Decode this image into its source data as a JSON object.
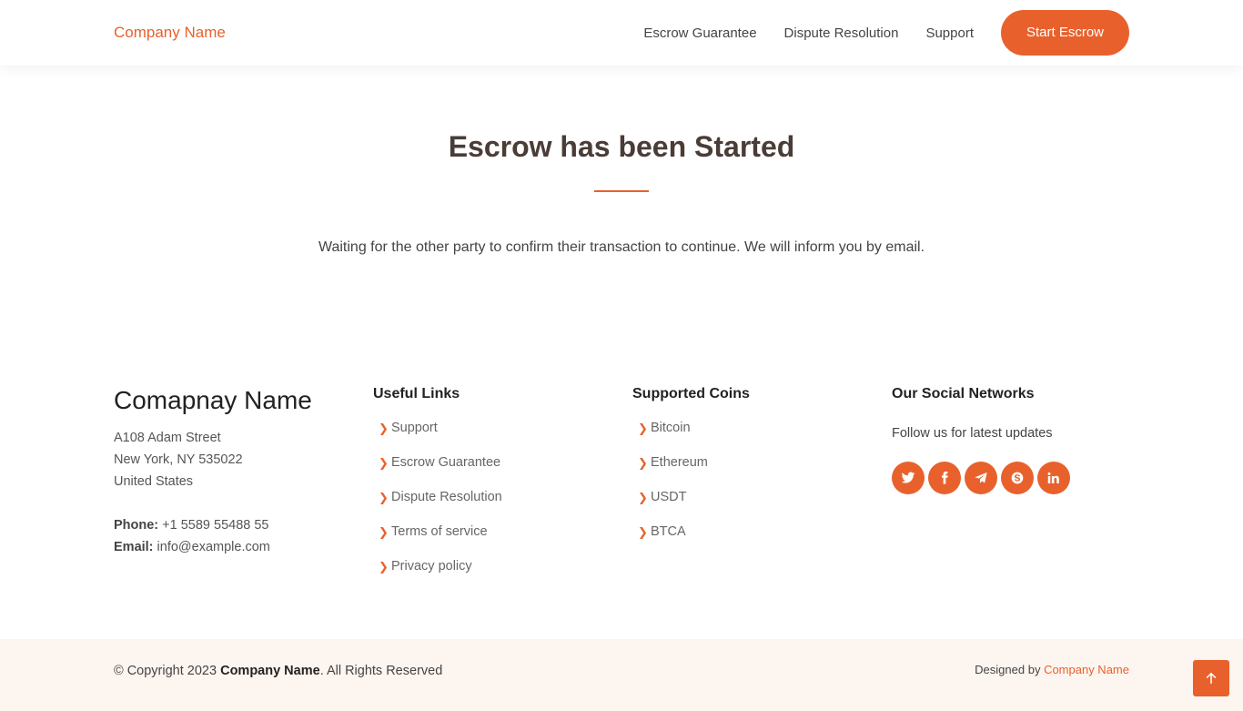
{
  "header": {
    "logo": "Company Name",
    "nav": [
      "Escrow Guarantee",
      "Dispute Resolution",
      "Support"
    ],
    "cta": "Start Escrow"
  },
  "main": {
    "title": "Escrow has been Started",
    "message": "Waiting for the other party to confirm their transaction to continue. We will inform you by email."
  },
  "footer": {
    "brand": "Comapnay Name",
    "address": [
      "A108 Adam Street",
      "New York, NY 535022",
      "United States"
    ],
    "phone_label": "Phone:",
    "phone": "+1 5589 55488 55",
    "email_label": "Email:",
    "email": "info@example.com",
    "useful_links": {
      "title": "Useful Links",
      "items": [
        "Support",
        "Escrow Guarantee",
        "Dispute Resolution",
        "Terms of service",
        "Privacy policy"
      ]
    },
    "coins": {
      "title": "Supported Coins",
      "items": [
        "Bitcoin",
        "Ethereum",
        "USDT",
        "BTCA"
      ]
    },
    "social": {
      "title": "Our Social Networks",
      "text": "Follow us for latest updates",
      "icons": [
        "twitter-icon",
        "facebook-icon",
        "telegram-icon",
        "skype-icon",
        "linkedin-icon"
      ]
    },
    "copyright_prefix": "© Copyright 2023 ",
    "copyright_brand": "Company Name",
    "copyright_suffix": ". All Rights Reserved",
    "designed_prefix": "Designed by ",
    "designed_brand": "Company Name"
  },
  "colors": {
    "accent": "#e8612c",
    "title": "#4a3c36",
    "bottom_bg": "#fdf5f0"
  }
}
